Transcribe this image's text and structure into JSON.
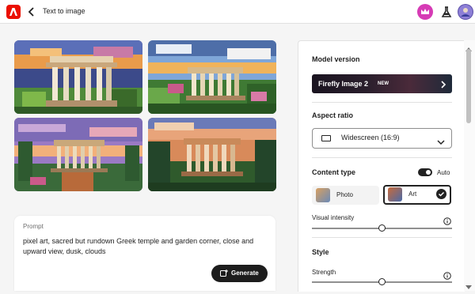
{
  "header": {
    "title": "Text to image",
    "icons": [
      "adobe-logo-icon",
      "back-arrow-icon",
      "premium-crown-icon",
      "beta-flask-icon",
      "user-avatar-icon"
    ]
  },
  "gallery": {
    "images": [
      {
        "name": "generated-image-1",
        "scene": "pixel art greek temple dusk clouds"
      },
      {
        "name": "generated-image-2",
        "scene": "pixel art greek temple on hill"
      },
      {
        "name": "generated-image-3",
        "scene": "pixel art greek temple purple sky"
      },
      {
        "name": "generated-image-4",
        "scene": "pixel art greek temple sunset"
      }
    ]
  },
  "prompt": {
    "label": "Prompt",
    "text": "pixel art, sacred but rundown Greek temple and garden corner, close and upward view, dusk, clouds",
    "generate_label": "Generate"
  },
  "panel": {
    "model_version_title": "Model version",
    "model_name": "Firefly Image 2",
    "model_badge": "NEW",
    "aspect_ratio_title": "Aspect ratio",
    "aspect_ratio_value": "Widescreen (16:9)",
    "content_type_title": "Content type",
    "auto_label": "Auto",
    "auto_enabled": true,
    "content_types": [
      {
        "label": "Photo",
        "selected": false
      },
      {
        "label": "Art",
        "selected": true
      }
    ],
    "visual_intensity_label": "Visual intensity",
    "visual_intensity_value": 0.5,
    "style_title": "Style",
    "strength_label": "Strength",
    "strength_value": 0.5
  },
  "colors": {
    "adobe_red": "#eb1000",
    "crown_pink": "#d63bb5",
    "avatar_purple": "#5b4fa8",
    "button_dark": "#1d1d1d"
  }
}
